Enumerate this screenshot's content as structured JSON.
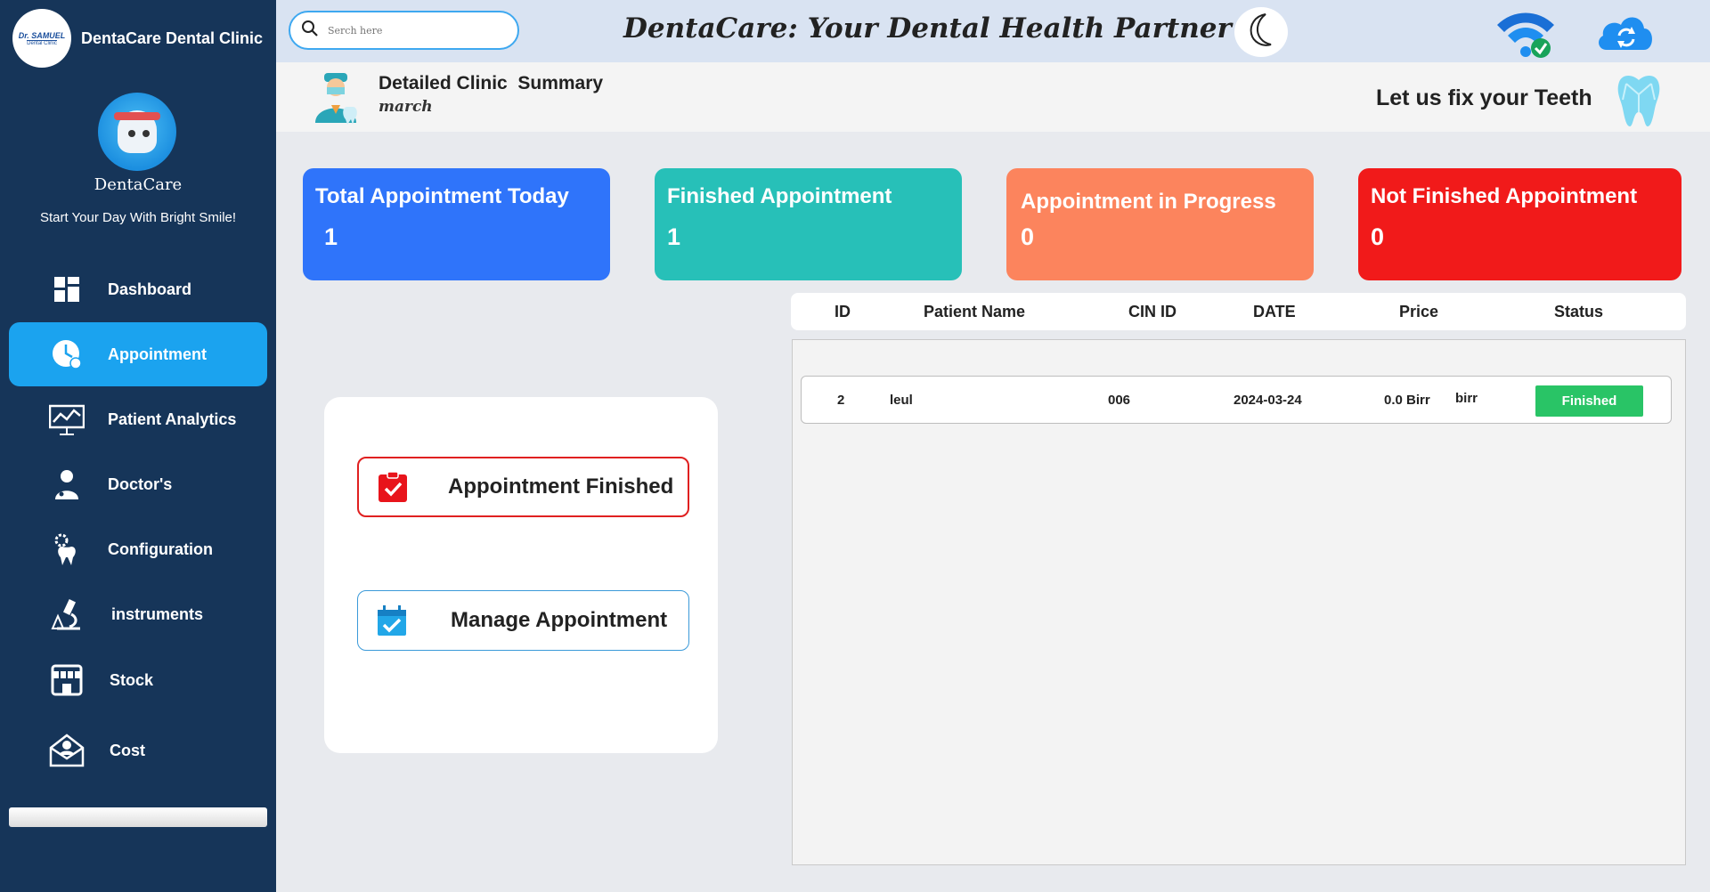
{
  "sidebar": {
    "brand_name": "DentaCare Dental Clinic",
    "logo_text": "Dr. SAMUEL",
    "logo_sub": "Dental Clinic",
    "avatar_name": "DentaCare",
    "tagline": "Start Your Day With Bright Smile!",
    "items": [
      {
        "label": "Dashboard",
        "icon": "dashboard-icon"
      },
      {
        "label": "Appointment",
        "icon": "clock-icon",
        "active": true
      },
      {
        "label": "Patient Analytics",
        "icon": "chart-board-icon"
      },
      {
        "label": "Doctor's",
        "icon": "doctor-icon"
      },
      {
        "label": "Configuration",
        "icon": "tooth-gear-icon"
      },
      {
        "label": "instruments",
        "icon": "microscope-icon"
      },
      {
        "label": "Stock",
        "icon": "store-icon"
      },
      {
        "label": "Cost",
        "icon": "envelope-person-icon"
      }
    ]
  },
  "topbar": {
    "search_placeholder": "Serch here",
    "title": "DentaCare: Your Dental Health Partner"
  },
  "summary": {
    "title": "Detailed Clinic  Summary",
    "subtitle": "march",
    "slogan": "Let us fix your Teeth"
  },
  "cards": [
    {
      "title": "Total Appointment Today",
      "value": "1",
      "color": "#2f74fa"
    },
    {
      "title": "Finished Appointment",
      "value": "1",
      "color": "#27c0b8"
    },
    {
      "title": "Appointment in Progress",
      "value": "0",
      "color": "#fc845d"
    },
    {
      "title": "Not Finished Appointment",
      "value": "0",
      "color": "#f11a1a"
    }
  ],
  "actions": {
    "finished_label": "Appointment Finished",
    "manage_label": "Manage Appointment"
  },
  "table": {
    "headers": [
      "ID",
      "Patient Name",
      "CIN ID",
      "DATE",
      "Price",
      "Status"
    ],
    "rows": [
      {
        "id": "2",
        "patient_name": "leul",
        "cin_id": "006",
        "date": "2024-03-24",
        "price": "0.0 Birr",
        "currency": "birr",
        "status": "Finished"
      }
    ]
  },
  "colors": {
    "sidebar_bg": "#163559",
    "active_nav": "#1ba3ef",
    "status_finished": "#29c466"
  }
}
